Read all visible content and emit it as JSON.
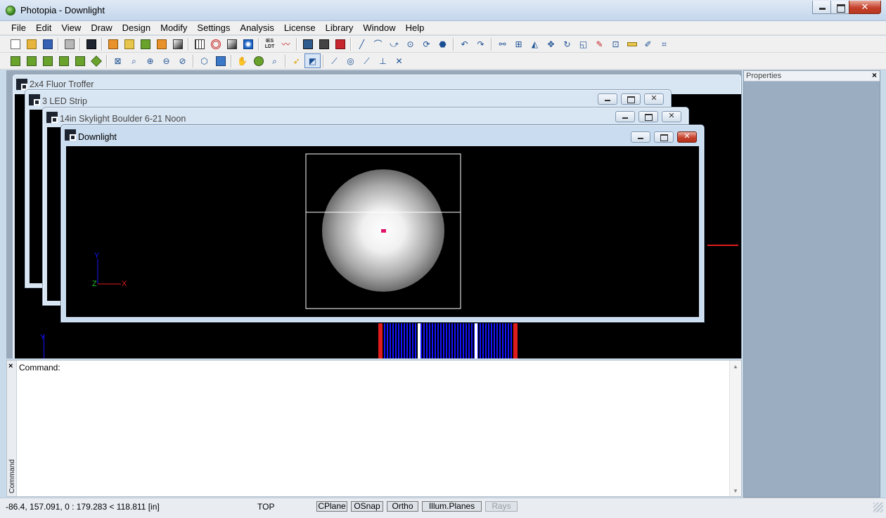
{
  "app": {
    "title": "Photopia - Downlight",
    "colors": {
      "titlebar": "#c4d6ec",
      "workspace_bg": "#9aa9ba",
      "viewport_bg": "#000000",
      "accent_red": "#e01b1b",
      "ray_blue": "#1414ff"
    }
  },
  "menu": [
    "File",
    "Edit",
    "View",
    "Draw",
    "Design",
    "Modify",
    "Settings",
    "Analysis",
    "License",
    "Library",
    "Window",
    "Help"
  ],
  "toolbar1": {
    "icons": [
      "new-document-icon",
      "open-folder-icon",
      "save-icon",
      "print-icon",
      "add-viewport-icon",
      "report-icon",
      "report2-icon",
      "calc-icon",
      "photometry-icon",
      "luminaire-icon",
      "grid-icon",
      "target-icon",
      "gray-render-icon",
      "blue-render-icon",
      "ies-ldt-label",
      "curve-icon",
      "monitor-icon",
      "calculator-icon",
      "red-calc-icon",
      "line-icon",
      "arc-icon",
      "polyline-icon",
      "circle-icon",
      "rotate-3d-icon",
      "shape-icon",
      "undo-icon",
      "redo-icon",
      "group-icon",
      "array-icon",
      "mirror-icon",
      "move-icon",
      "rotate-icon",
      "scale-icon",
      "wand-icon",
      "snap-icon",
      "measure-icon",
      "pencil-icon",
      "trim-icon"
    ],
    "ies_label": "IES LDT"
  },
  "toolbar2": {
    "icons": [
      "view-front-icon",
      "view-right-icon",
      "view-back-icon",
      "view-left-icon",
      "view-top-icon",
      "view-iso-icon",
      "zoom-extents-icon",
      "zoom-window-icon",
      "zoom-in-icon",
      "zoom-out-icon",
      "zoom-prev-icon",
      "cube-icon",
      "cube-shaded-icon",
      "pan-hand-icon",
      "sphere-icon",
      "zoom-realtime-icon",
      "pick-point-icon",
      "plane-view-icon",
      "snap-end-icon",
      "snap-center-icon",
      "snap-mid-icon",
      "snap-perp-icon",
      "snap-intersect-icon"
    ]
  },
  "windows": [
    {
      "title": "2x4 Fluor Troffer"
    },
    {
      "title": "3 LED Strip"
    },
    {
      "title": "14in Skylight Boulder 6-21 Noon"
    },
    {
      "title": "Downlight"
    }
  ],
  "viewport": {
    "axis_y": "Y",
    "axis_x": "X",
    "axis_z": "Z"
  },
  "properties": {
    "title": "Properties",
    "close": "×"
  },
  "command": {
    "prompt": "Command:",
    "side_label": "Command",
    "close": "×"
  },
  "status": {
    "coords": "-86.4, 157.091, 0 : 179.283 < 118.811 [in]",
    "view": "TOP",
    "toggles": [
      {
        "label": "CPlane",
        "enabled": true
      },
      {
        "label": "OSnap",
        "enabled": true
      },
      {
        "label": "Ortho",
        "enabled": true
      },
      {
        "label": "Illum.Planes",
        "enabled": true
      },
      {
        "label": "Rays",
        "enabled": false
      }
    ]
  }
}
